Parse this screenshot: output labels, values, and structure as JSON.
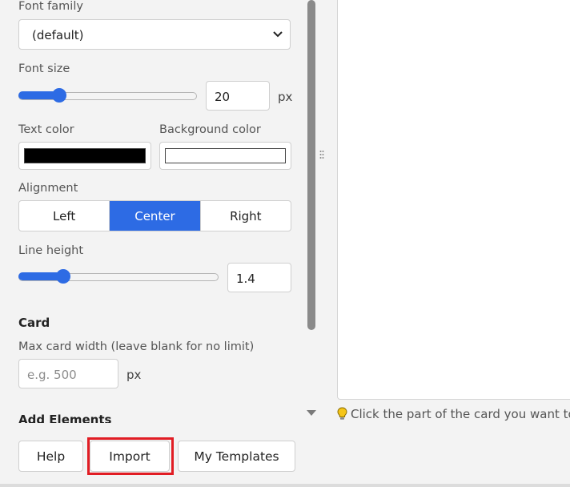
{
  "font": {
    "family_label": "Font family",
    "family_value": "(default)",
    "size_label": "Font size",
    "size_value": "20",
    "size_unit": "px",
    "size_slider_fraction": 0.22,
    "text_color_label": "Text color",
    "text_color": "#000000",
    "bg_color_label": "Background color",
    "bg_color": "#ffffff"
  },
  "alignment": {
    "label": "Alignment",
    "options": [
      "Left",
      "Center",
      "Right"
    ],
    "selected": "Center"
  },
  "line_height": {
    "label": "Line height",
    "value": "1.4",
    "slider_fraction": 0.22
  },
  "card": {
    "title": "Card",
    "max_width_label": "Max card width (leave blank for no limit)",
    "max_width_placeholder": "e.g. 500",
    "max_width_value": "",
    "unit": "px"
  },
  "add_elements_title": "Add Elements",
  "buttons": {
    "help": "Help",
    "import": "Import",
    "templates": "My Templates"
  },
  "hint": {
    "text": "Click the part of the card you want to c"
  },
  "colors": {
    "accent": "#2d6be4",
    "highlight": "#e11d24"
  },
  "icons": {
    "select_arrow": "chevron-down-icon",
    "hint": "lightbulb-icon",
    "scroll_down": "scroll-down-arrow-icon",
    "resize": "resize-handle-icon"
  }
}
